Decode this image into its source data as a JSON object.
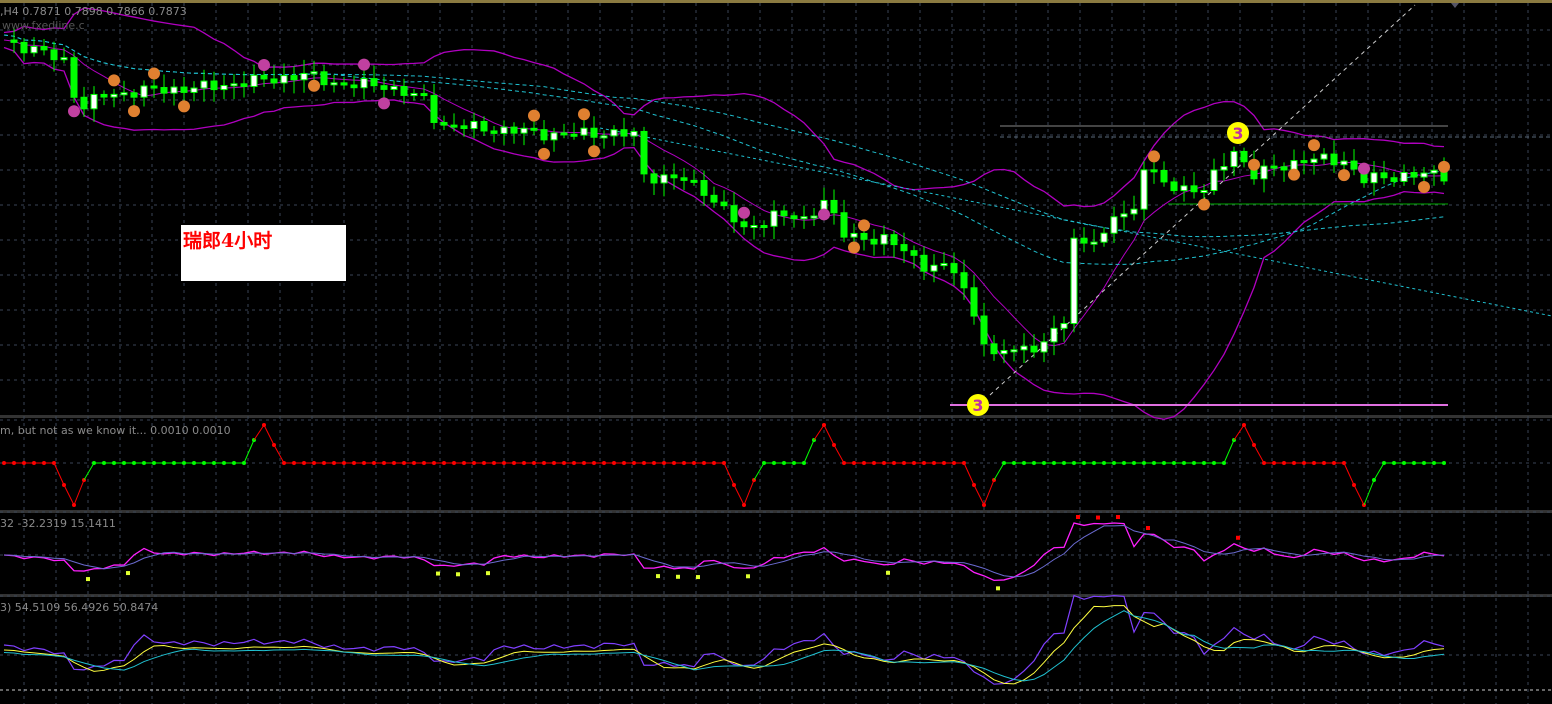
{
  "header": {
    "symbol_tf": ",H4",
    "ohlc": "0.7871 0.7898 0.7866 0.7873",
    "watermark": "www.fxedline.c"
  },
  "note_label": "瑞郎4小时",
  "panels": {
    "step_indicator_label": "m, but not as we know it...  0.0010 0.0010",
    "oscillator_label": "32 -32.2319 15.1411",
    "rsi_label": "3) 54.5109 56.4926 50.8474"
  },
  "markers": {
    "wave_label": "3"
  },
  "colors": {
    "bull": "#ffffff",
    "bear": "#00ff00",
    "outline": "#00ff00",
    "bands": "#b000c0",
    "ma": "#20c0d0",
    "grid": "#3a4456",
    "signal_up": "#00ff00",
    "signal_down": "#ff0000"
  },
  "chart_data": {
    "type": "candlestick",
    "timeframe": "H4",
    "price_range": [
      0.76,
      0.79
    ],
    "close_keypoints": [
      [
        0,
        0.7884
      ],
      [
        6,
        0.7868
      ],
      [
        7.5,
        0.7828
      ],
      [
        10,
        0.784
      ],
      [
        15,
        0.7844
      ],
      [
        20,
        0.7846
      ],
      [
        26,
        0.7852
      ],
      [
        30,
        0.7856
      ],
      [
        34,
        0.7848
      ],
      [
        38,
        0.7848
      ],
      [
        42,
        0.7836
      ],
      [
        43.5,
        0.7816
      ],
      [
        50,
        0.7812
      ],
      [
        56,
        0.7808
      ],
      [
        60,
        0.781
      ],
      [
        63,
        0.7808
      ],
      [
        64,
        0.7776
      ],
      [
        68,
        0.7772
      ],
      [
        70,
        0.7764
      ],
      [
        74,
        0.7732
      ],
      [
        77,
        0.7744
      ],
      [
        80,
        0.774
      ],
      [
        82,
        0.7756
      ],
      [
        84,
        0.7728
      ],
      [
        88,
        0.7724
      ],
      [
        90,
        0.7716
      ],
      [
        92,
        0.7704
      ],
      [
        95,
        0.77
      ],
      [
        96.5,
        0.7676
      ],
      [
        98,
        0.7644
      ],
      [
        99,
        0.7628
      ],
      [
        100,
        0.7636
      ],
      [
        104,
        0.764
      ],
      [
        106,
        0.766
      ],
      [
        107,
        0.7724
      ],
      [
        110,
        0.7724
      ],
      [
        111,
        0.7744
      ],
      [
        113,
        0.7748
      ],
      [
        114,
        0.7784
      ],
      [
        116,
        0.7768
      ],
      [
        120,
        0.7764
      ],
      [
        123,
        0.7796
      ],
      [
        125,
        0.7776
      ],
      [
        128,
        0.7784
      ],
      [
        130,
        0.7788
      ],
      [
        134,
        0.7788
      ],
      [
        136,
        0.7772
      ],
      [
        140,
        0.7776
      ],
      [
        145,
        0.7776
      ]
    ],
    "step_signal": {
      "green_ranges": [
        [
          9,
          25
        ],
        [
          76,
          81
        ],
        [
          100,
          123
        ],
        [
          137,
          145
        ]
      ],
      "peaks": [
        26,
        82,
        124
      ],
      "troughs": [
        7,
        74,
        98,
        136
      ]
    },
    "wave_markers_bars": [
      98,
      124
    ]
  }
}
